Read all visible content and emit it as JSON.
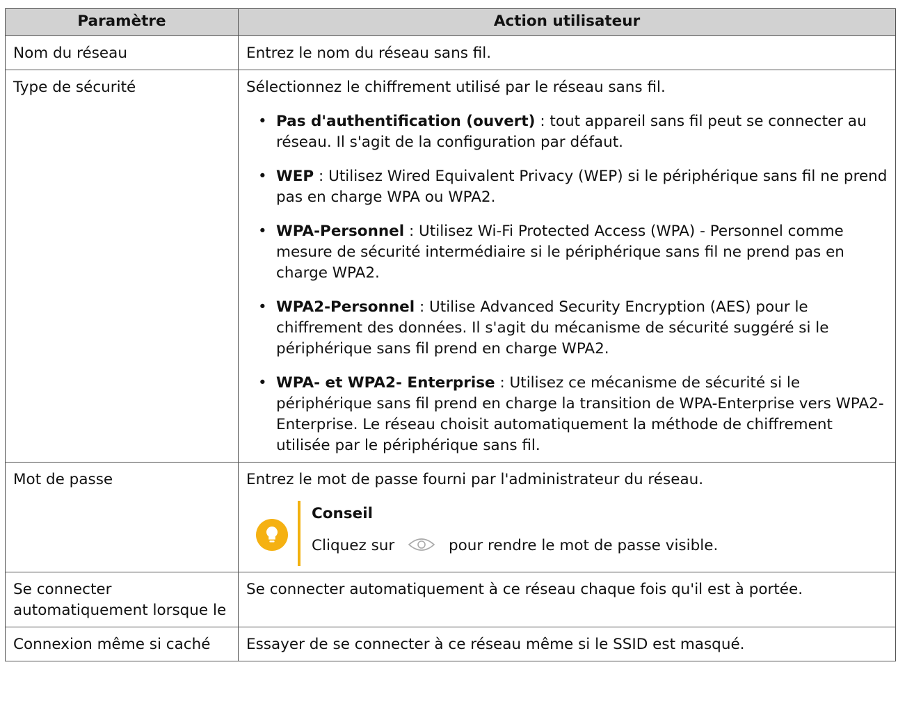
{
  "table": {
    "headers": [
      "Paramètre",
      "Action utilisateur"
    ],
    "rows": {
      "network_name": {
        "param": "Nom du réseau",
        "action": "Entrez le nom du réseau sans fil."
      },
      "security_type": {
        "param": "Type de sécurité",
        "intro": "Sélectionnez le chiffrement utilisé par le réseau sans fil.",
        "bullets": [
          {
            "term": "Pas d'authentification (ouvert)",
            "desc": " : tout appareil sans fil peut se connecter au réseau. Il s'agit de la configuration par défaut."
          },
          {
            "term": "WEP",
            "desc": " : Utilisez Wired Equivalent Privacy (WEP) si le périphérique sans fil ne prend pas en charge WPA ou WPA2."
          },
          {
            "term": "WPA-Personnel",
            "desc": " : Utilisez Wi-Fi Protected Access (WPA) - Personnel comme mesure de sécurité intermédiaire si le périphérique sans fil ne prend pas en charge WPA2."
          },
          {
            "term": "WPA2-Personnel",
            "desc": " : Utilise Advanced Security Encryption (AES) pour le chiffrement des données. Il s'agit du mécanisme de sécurité suggéré si le périphérique sans fil prend en charge WPA2."
          },
          {
            "term": "WPA- et WPA2- Enterprise",
            "desc": " : Utilisez ce mécanisme de sécurité si le périphérique sans fil prend en charge la transition de WPA-Enterprise vers WPA2-Enterprise. Le réseau choisit automatiquement la méthode de chiffrement utilisée par le périphérique sans fil."
          }
        ]
      },
      "password": {
        "param": "Mot de passe",
        "action": "Entrez le mot de passe fourni par l'administrateur du réseau.",
        "tip_title": "Conseil",
        "tip_before": "Cliquez sur",
        "tip_after": "pour rendre le mot de passe visible.",
        "tip_icon": "lightbulb-icon",
        "eye_icon": "eye-icon"
      },
      "auto_connect": {
        "param": "Se connecter automatiquement lorsque le",
        "action": "Se connecter automatiquement à ce réseau chaque fois qu'il est à portée."
      },
      "hidden": {
        "param": "Connexion même si caché",
        "action": "Essayer de se connecter à ce réseau même si le SSID est masqué."
      }
    }
  },
  "colors": {
    "header_bg": "#d2d2d2",
    "border": "#555555",
    "tip_accent": "#f2b10f",
    "tip_icon_circle": "#f5b112"
  }
}
